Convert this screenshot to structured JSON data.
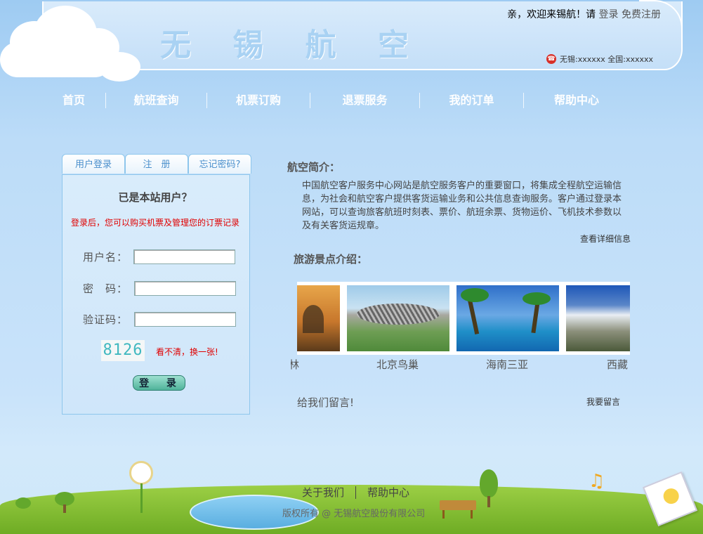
{
  "header": {
    "site_title": "无 锡 航 空",
    "welcome_text": "亲，欢迎来锡航！请",
    "login_link": "登录",
    "register_link": "免费注册",
    "hotline": "无锡:xxxxxx 全国:xxxxxx"
  },
  "nav": {
    "items": [
      "首页",
      "航班查询",
      "机票订购",
      "退票服务",
      "我的订单",
      "帮助中心"
    ]
  },
  "login": {
    "tabs": [
      "用户登录",
      "注　册",
      "忘记密码?"
    ],
    "title": "已是本站用户？",
    "note": "登录后，您可以购买机票及管理您的订票记录",
    "username_label": "用户名：",
    "password_label": "密　码：",
    "captcha_label": "验证码：",
    "captcha_code": "8126",
    "captcha_refresh": "看不清，换一张!",
    "submit_label": "登 录"
  },
  "intro": {
    "title": "航空简介：",
    "text": "中国航空客户服务中心网站是航空服务客户的重要窗口，将集成全程航空运输信息，为社会和航空客户提供客货运输业务和公共信息查询服务。客户通过登录本网站，可以查询旅客航班时刻表、票价、航班余票、货物运价、飞机技术参数以及有关客货运规章。",
    "more_link": "查看详细信息"
  },
  "spots": {
    "title": "旅游景点介绍：",
    "captions": [
      "林",
      "北京鸟巢",
      "海南三亚",
      "西藏"
    ]
  },
  "guestbook": {
    "label": "给我们留言!",
    "action": "我要留言"
  },
  "footer": {
    "links": [
      "关于我们",
      "帮助中心"
    ],
    "copyright": "版权所有 @ 无锡航空股份有限公司"
  },
  "colors": {
    "nav_text": "#ffffff",
    "note_red": "#e00000",
    "panel_border": "#8ec6ec"
  }
}
